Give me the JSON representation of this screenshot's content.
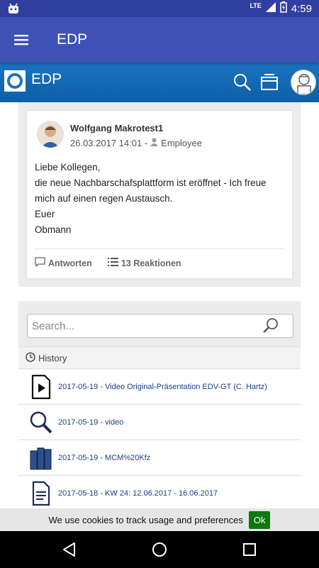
{
  "status_bar": {
    "network": "LTE",
    "time": "4:59"
  },
  "app_bar": {
    "title": "EDP"
  },
  "site_header": {
    "title": "EDP"
  },
  "post": {
    "author": "Wolfgang Makrotest1",
    "date": "26.03.2017 14:01 -",
    "role": "Employee",
    "body_lines": [
      "Liebe Kollegen,",
      "die neue Nachbarschafsplattform ist eröffnet - Ich freue",
      "mich auf einen regen Austausch.",
      "Euer",
      "Obmann"
    ],
    "reply_label": "Antworten",
    "reactions_label": "13 Reaktionen"
  },
  "history": {
    "search_placeholder": "Search...",
    "header": "History",
    "items": [
      {
        "label": "2017-05-19 - Video Original-Präsentation EDV-GT (C. Hartz)",
        "icon": "video-file-icon"
      },
      {
        "label": "2017-05-19 - video",
        "icon": "search-icon"
      },
      {
        "label": "2017-05-19 - MCM%20Kfz",
        "icon": "books-icon"
      },
      {
        "label": "2017-05-18 - KW 24: 12.06.2017 - 16.06.2017",
        "icon": "document-icon"
      }
    ]
  },
  "cookie": {
    "message": "We use cookies to track usage and preferences",
    "ok_label": "Ok"
  },
  "colors": {
    "status_bar": "#303f9f",
    "app_bar": "#3f51b5",
    "site_header": "#1a73c0",
    "link": "#1a3f86",
    "ok_button": "#0b7a0b"
  }
}
